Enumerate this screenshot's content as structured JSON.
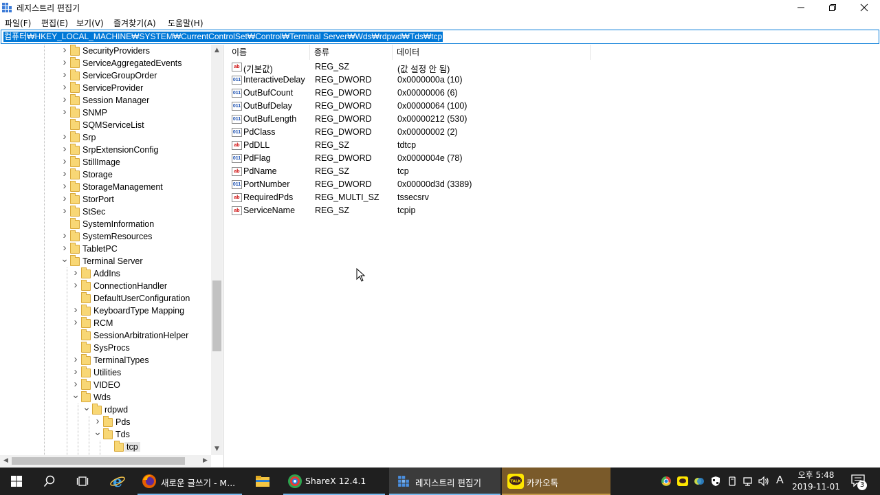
{
  "window": {
    "title": "레지스트리 편집기"
  },
  "menu": [
    "파일(F)",
    "편집(E)",
    "보기(V)",
    "즐겨찾기(A)",
    "도움말(H)"
  ],
  "address": "컴퓨터₩HKEY_LOCAL_MACHINE₩SYSTEM₩CurrentControlSet₩Control₩Terminal Server₩Wds₩rdpwd₩Tds₩tcp",
  "tree": [
    {
      "label": "SecurityProviders",
      "level": 0,
      "exp": ">"
    },
    {
      "label": "ServiceAggregatedEvents",
      "level": 0,
      "exp": ">"
    },
    {
      "label": "ServiceGroupOrder",
      "level": 0,
      "exp": ">"
    },
    {
      "label": "ServiceProvider",
      "level": 0,
      "exp": ">"
    },
    {
      "label": "Session Manager",
      "level": 0,
      "exp": ">"
    },
    {
      "label": "SNMP",
      "level": 0,
      "exp": ">"
    },
    {
      "label": "SQMServiceList",
      "level": 0,
      "exp": ""
    },
    {
      "label": "Srp",
      "level": 0,
      "exp": ">"
    },
    {
      "label": "SrpExtensionConfig",
      "level": 0,
      "exp": ">"
    },
    {
      "label": "StillImage",
      "level": 0,
      "exp": ">"
    },
    {
      "label": "Storage",
      "level": 0,
      "exp": ">"
    },
    {
      "label": "StorageManagement",
      "level": 0,
      "exp": ">"
    },
    {
      "label": "StorPort",
      "level": 0,
      "exp": ">"
    },
    {
      "label": "StSec",
      "level": 0,
      "exp": ">"
    },
    {
      "label": "SystemInformation",
      "level": 0,
      "exp": ""
    },
    {
      "label": "SystemResources",
      "level": 0,
      "exp": ">"
    },
    {
      "label": "TabletPC",
      "level": 0,
      "exp": ">"
    },
    {
      "label": "Terminal Server",
      "level": 0,
      "exp": "v"
    },
    {
      "label": "AddIns",
      "level": 1,
      "exp": ">"
    },
    {
      "label": "ConnectionHandler",
      "level": 1,
      "exp": ">"
    },
    {
      "label": "DefaultUserConfiguration",
      "level": 1,
      "exp": ""
    },
    {
      "label": "KeyboardType Mapping",
      "level": 1,
      "exp": ">"
    },
    {
      "label": "RCM",
      "level": 1,
      "exp": ">"
    },
    {
      "label": "SessionArbitrationHelper",
      "level": 1,
      "exp": ""
    },
    {
      "label": "SysProcs",
      "level": 1,
      "exp": ""
    },
    {
      "label": "TerminalTypes",
      "level": 1,
      "exp": ">"
    },
    {
      "label": "Utilities",
      "level": 1,
      "exp": ">"
    },
    {
      "label": "VIDEO",
      "level": 1,
      "exp": ">"
    },
    {
      "label": "Wds",
      "level": 1,
      "exp": "v"
    },
    {
      "label": "rdpwd",
      "level": 2,
      "exp": "v"
    },
    {
      "label": "Pds",
      "level": 3,
      "exp": ">"
    },
    {
      "label": "Tds",
      "level": 3,
      "exp": "v"
    },
    {
      "label": "tcp",
      "level": 4,
      "exp": "",
      "selected": true
    }
  ],
  "columns": [
    "이름",
    "종류",
    "데이터"
  ],
  "values": [
    {
      "name": "(기본값)",
      "type": "REG_SZ",
      "data": "(값 설정 안 됨)",
      "icon": "ab"
    },
    {
      "name": "InteractiveDelay",
      "type": "REG_DWORD",
      "data": "0x0000000a (10)",
      "icon": "011"
    },
    {
      "name": "OutBufCount",
      "type": "REG_DWORD",
      "data": "0x00000006 (6)",
      "icon": "011"
    },
    {
      "name": "OutBufDelay",
      "type": "REG_DWORD",
      "data": "0x00000064 (100)",
      "icon": "011"
    },
    {
      "name": "OutBufLength",
      "type": "REG_DWORD",
      "data": "0x00000212 (530)",
      "icon": "011"
    },
    {
      "name": "PdClass",
      "type": "REG_DWORD",
      "data": "0x00000002 (2)",
      "icon": "011"
    },
    {
      "name": "PdDLL",
      "type": "REG_SZ",
      "data": "tdtcp",
      "icon": "ab"
    },
    {
      "name": "PdFlag",
      "type": "REG_DWORD",
      "data": "0x0000004e (78)",
      "icon": "011"
    },
    {
      "name": "PdName",
      "type": "REG_SZ",
      "data": "tcp",
      "icon": "ab"
    },
    {
      "name": "PortNumber",
      "type": "REG_DWORD",
      "data": "0x00000d3d (3389)",
      "icon": "011"
    },
    {
      "name": "RequiredPds",
      "type": "REG_MULTI_SZ",
      "data": "tssecsrv",
      "icon": "ab"
    },
    {
      "name": "ServiceName",
      "type": "REG_SZ",
      "data": "tcpip",
      "icon": "ab"
    }
  ],
  "taskbar": {
    "apps": [
      {
        "label": "새로운 글쓰기 - M...",
        "icon": "firefox-icon"
      },
      {
        "label": "ShareX 12.4.1",
        "icon": "sharex-icon"
      },
      {
        "label": "레지스트리 편집기",
        "icon": "regedit-icon",
        "active": true
      },
      {
        "label": "카카오톡",
        "icon": "kakaotalk-icon"
      }
    ],
    "ime": "A",
    "time": "오후 5:48",
    "date": "2019-11-01",
    "notifications": "3"
  }
}
